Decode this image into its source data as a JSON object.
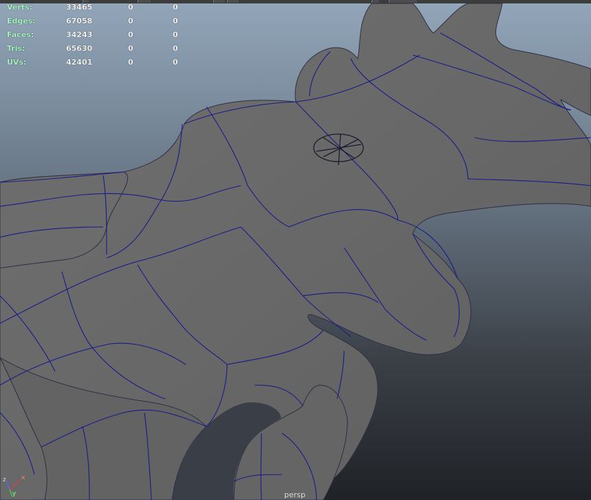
{
  "viewport": {
    "camera": "persp",
    "colors": {
      "mesh": "#6a6a6a",
      "wireframe": "#1a1a8a",
      "stat_label": "#a9f0c4",
      "stat_value": "#f2f2f2"
    }
  },
  "heads_up": {
    "rows": [
      {
        "label": "Verts:",
        "values": [
          "33465",
          "0",
          "0"
        ]
      },
      {
        "label": "Edges:",
        "values": [
          "67058",
          "0",
          "0"
        ]
      },
      {
        "label": "Faces:",
        "values": [
          "34243",
          "0",
          "0"
        ]
      },
      {
        "label": "Tris:",
        "values": [
          "65630",
          "0",
          "0"
        ]
      },
      {
        "label": "UVs:",
        "values": [
          "42401",
          "0",
          "0"
        ]
      }
    ]
  },
  "axis_gizmo": {
    "axes": [
      {
        "label": "x",
        "color": "#e04040"
      },
      {
        "label": "y",
        "color": "#40e040"
      },
      {
        "label": "z",
        "color": "#4a6cff"
      }
    ]
  }
}
